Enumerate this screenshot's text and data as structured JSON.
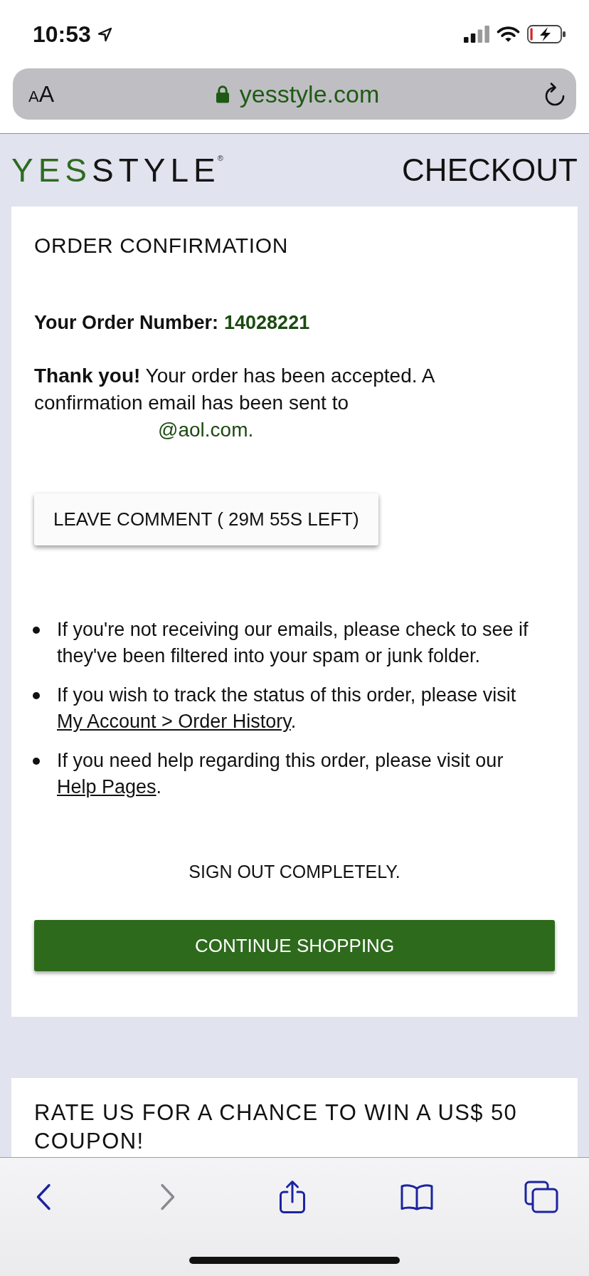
{
  "status_bar": {
    "time": "10:53"
  },
  "address_bar": {
    "text_size_button": "AA",
    "url": "yesstyle.com"
  },
  "header": {
    "logo": {
      "first": "YES",
      "rest": "STYLE",
      "registered_mark": "®"
    },
    "title": "CHECKOUT"
  },
  "confirmation_card": {
    "title": "ORDER CONFIRMATION",
    "order_number_label": "Your Order Number:",
    "order_number": "14028221",
    "message": "**Thank you!** Your order has been accepted. A confirmation email has been sent to",
    "email": "@aol.com.",
    "comment_button": "LEAVE COMMENT ( 29M 55S LEFT)",
    "tips": [
      {
        "text": "If you're not receiving our emails, please check to see if they've been filtered into your spam or junk folder."
      },
      {
        "text": "If you wish to track the status of this order, please visit",
        "link": "My Account > Order History",
        "after": "."
      },
      {
        "text": "If you need help regarding this order, please visit our",
        "link": "Help Pages",
        "after": "."
      }
    ],
    "sign_out": "SIGN OUT COMPLETELY.",
    "continue_button": "CONTINUE SHOPPING"
  },
  "rating_card": {
    "title": "RATE US FOR A CHANCE TO WIN A US$ 50 COUPON!"
  },
  "toolbar": {
    "buttons": [
      {
        "kind": "back",
        "disabled": false
      },
      {
        "kind": "forward",
        "disabled": true
      },
      {
        "kind": "share",
        "disabled": false
      },
      {
        "kind": "bookmarks",
        "disabled": false
      },
      {
        "kind": "tabs",
        "disabled": false
      }
    ]
  }
}
